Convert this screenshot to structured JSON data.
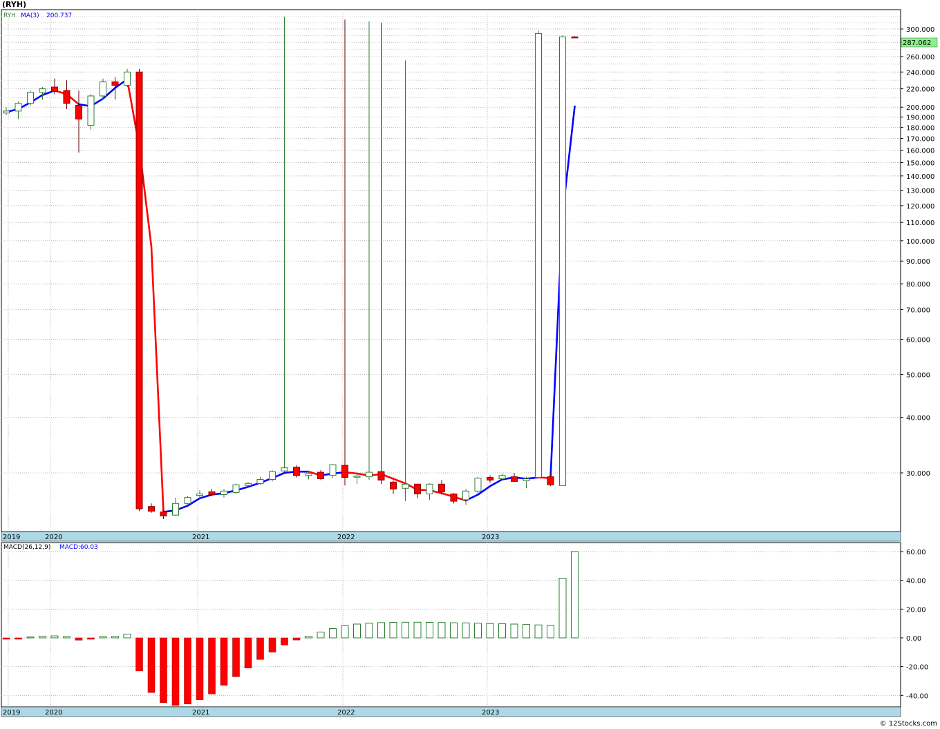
{
  "title": "(RYH)",
  "legend": {
    "symbol": "RYH",
    "ma_label": "MA(3)",
    "ma_value": "200.737",
    "macd_label": "MACD(26,12,9)",
    "macd_value_label": "MACD:60.03"
  },
  "last_price_label": "287.062",
  "footer": "© 12Stocks.com",
  "colors": {
    "up": "#2e7d32",
    "down": "#ff0000",
    "ma_up": "#0000ff",
    "ma_down": "#ff0000",
    "axis_band": "#add8e6",
    "price_tag": "#90ee90"
  },
  "chart_data": [
    {
      "type": "candlestick",
      "scale": "log",
      "ylim": [
        22,
        330
      ],
      "x_tick_labels": [
        "2019",
        "2020",
        "2021",
        "2022",
        "2023"
      ],
      "y_tick_labels": [
        "300.000",
        "280.000",
        "260.000",
        "240.000",
        "220.000",
        "200.000",
        "190.000",
        "180.000",
        "170.000",
        "160.000",
        "150.000",
        "140.000",
        "130.000",
        "120.000",
        "110.000",
        "100.000",
        "90.000",
        "80.000",
        "70.000",
        "60.000",
        "50.000",
        "40.000",
        "30.000"
      ],
      "y_ticks": [
        300,
        280,
        260,
        240,
        220,
        200,
        190,
        180,
        170,
        160,
        150,
        140,
        130,
        120,
        110,
        100,
        90,
        80,
        70,
        60,
        50,
        40,
        30
      ],
      "months": [
        "2019-12",
        "2020-01",
        "2020-02",
        "2020-03",
        "2020-04",
        "2020-05",
        "2020-06",
        "2020-07",
        "2020-08",
        "2020-09",
        "2020-10",
        "2020-11",
        "2020-12",
        "2021-01",
        "2021-02",
        "2021-03",
        "2021-04",
        "2021-05",
        "2021-06",
        "2021-07",
        "2021-08",
        "2021-09",
        "2021-10",
        "2021-11",
        "2021-12",
        "2022-01",
        "2022-02",
        "2022-03",
        "2022-04",
        "2022-05",
        "2022-06",
        "2022-07",
        "2022-08",
        "2022-09",
        "2022-10",
        "2022-11",
        "2022-12",
        "2023-01",
        "2023-02",
        "2023-03",
        "2023-04",
        "2023-05",
        "2023-06",
        "2023-07"
      ],
      "ohlc": [
        [
          194,
          200,
          192,
          196
        ],
        [
          196,
          206,
          188,
          204
        ],
        [
          204,
          218,
          202,
          216
        ],
        [
          216,
          222,
          208,
          220
        ],
        [
          222,
          232,
          214,
          217
        ],
        [
          218,
          230,
          198,
          204
        ],
        [
          202,
          218,
          158,
          188
        ],
        [
          182,
          214,
          178,
          212
        ],
        [
          212,
          232,
          208,
          228
        ],
        [
          228,
          234,
          208,
          224
        ],
        [
          224,
          244,
          222,
          240
        ],
        [
          240,
          244,
          24.6,
          24.9
        ],
        [
          25.2,
          25.6,
          24.4,
          24.6
        ],
        [
          24.5,
          24.8,
          23.6,
          24.0
        ],
        [
          24.1,
          26.4,
          24.0,
          25.6
        ],
        [
          25.6,
          26.6,
          25.3,
          26.4
        ],
        [
          26.7,
          27.4,
          26.2,
          26.9
        ],
        [
          27.2,
          27.6,
          26.6,
          26.8
        ],
        [
          26.8,
          27.6,
          26.4,
          27.3
        ],
        [
          27.1,
          28.4,
          26.9,
          28.2
        ],
        [
          28.1,
          28.6,
          27.8,
          28.4
        ],
        [
          28.4,
          29.4,
          28.2,
          29.0
        ],
        [
          29.0,
          30.4,
          28.7,
          30.2
        ],
        [
          30.3,
          320,
          30.1,
          30.8
        ],
        [
          30.9,
          31.2,
          29.3,
          29.6
        ],
        [
          29.6,
          30.1,
          29.0,
          29.9
        ],
        [
          30.1,
          30.4,
          28.9,
          29.1
        ],
        [
          29.6,
          31.4,
          29.2,
          31.3
        ],
        [
          31.2,
          315,
          28.1,
          29.3
        ],
        [
          29.5,
          29.8,
          28.3,
          29.5
        ],
        [
          29.4,
          312,
          28.9,
          30.1
        ],
        [
          30.2,
          310,
          28.3,
          28.9
        ],
        [
          28.6,
          28.8,
          26.9,
          27.6
        ],
        [
          27.7,
          255,
          25.9,
          28.3
        ],
        [
          28.3,
          28.3,
          26.3,
          26.9
        ],
        [
          26.9,
          28.4,
          26.1,
          28.3
        ],
        [
          28.3,
          28.9,
          26.8,
          27.2
        ],
        [
          26.9,
          27.0,
          25.6,
          25.9
        ],
        [
          26.1,
          27.6,
          25.4,
          27.3
        ],
        [
          27.3,
          29.4,
          27.0,
          29.2
        ],
        [
          29.3,
          29.6,
          28.5,
          28.9
        ],
        [
          29.1,
          29.9,
          28.9,
          29.6
        ],
        [
          29.4,
          30.0,
          28.9,
          28.7
        ],
        [
          28.8,
          29.4,
          27.7,
          29.1
        ],
        [
          29.3,
          297,
          29.4,
          293
        ],
        [
          29.4,
          29.9,
          28.0,
          28.2
        ],
        [
          28.1,
          290,
          28.1,
          288
        ],
        [
          288,
          289,
          286,
          287.062
        ]
      ],
      "ma3": [
        195,
        198,
        205,
        213,
        218,
        214,
        203,
        201,
        209,
        221,
        231,
        163,
        97,
        24.5,
        24.7,
        25.3,
        26.3,
        26.8,
        27.0,
        27.4,
        27.9,
        28.5,
        29.2,
        30.0,
        30.2,
        30.2,
        29.6,
        29.9,
        30.1,
        29.9,
        29.6,
        29.8,
        29.1,
        28.4,
        27.5,
        27.4,
        27.0,
        26.5,
        26.0,
        26.8,
        28.0,
        29.0,
        29.3,
        29.1,
        29.3,
        29.2,
        115,
        200.737
      ],
      "ma3_dir": [
        "up",
        "up",
        "up",
        "up",
        "up",
        "down",
        "down",
        "up",
        "up",
        "up",
        "up",
        "down",
        "down",
        "down",
        "up",
        "up",
        "up",
        "up",
        "up",
        "up",
        "up",
        "up",
        "up",
        "up",
        "up",
        "up",
        "down",
        "up",
        "up",
        "down",
        "down",
        "down",
        "down",
        "down",
        "down",
        "down",
        "down",
        "down",
        "down",
        "up",
        "up",
        "up",
        "up",
        "up",
        "up",
        "down",
        "up",
        "up"
      ]
    },
    {
      "type": "bar",
      "name": "MACD(26,12,9)",
      "ylim": [
        -48,
        62
      ],
      "y_tick_labels": [
        "60.00",
        "40.00",
        "20.00",
        "0.00",
        "-20.00",
        "-40.00"
      ],
      "y_ticks": [
        60,
        40,
        20,
        0,
        -20,
        -40
      ],
      "values": [
        -0.8,
        -0.6,
        0.6,
        1.2,
        1.4,
        0.8,
        -1.6,
        -0.9,
        0.8,
        1.0,
        2.6,
        -23,
        -38,
        -45,
        -47,
        -46,
        -43,
        -39,
        -33,
        -27,
        -21,
        -15,
        -10,
        -5,
        -1.5,
        1.2,
        4.0,
        6.5,
        8.5,
        9.6,
        10.2,
        10.6,
        10.8,
        10.9,
        10.9,
        10.8,
        10.7,
        10.5,
        10.4,
        10.2,
        10.0,
        9.8,
        9.6,
        9.3,
        9.0,
        8.8,
        41.5,
        60.03
      ]
    }
  ]
}
